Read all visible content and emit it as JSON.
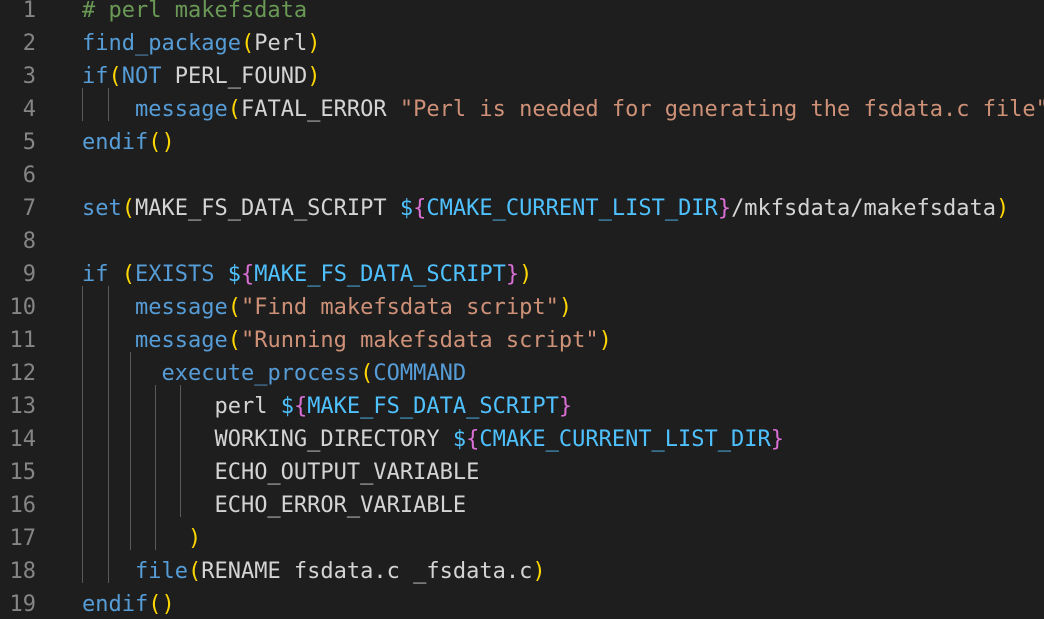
{
  "editor": {
    "lines": [
      {
        "num": "1",
        "indent": "",
        "tokens": [
          {
            "t": "# perl makefsdata",
            "c": "cmt"
          }
        ]
      },
      {
        "num": "2",
        "indent": "",
        "tokens": [
          {
            "t": "find_package",
            "c": "fn"
          },
          {
            "t": "(",
            "c": "p1"
          },
          {
            "t": "Perl",
            "c": "id"
          },
          {
            "t": ")",
            "c": "p1"
          }
        ]
      },
      {
        "num": "3",
        "indent": "",
        "tokens": [
          {
            "t": "if",
            "c": "fn"
          },
          {
            "t": "(",
            "c": "p1"
          },
          {
            "t": "NOT",
            "c": "kw"
          },
          {
            "t": " PERL_FOUND",
            "c": "id"
          },
          {
            "t": ")",
            "c": "p1"
          }
        ]
      },
      {
        "num": "4",
        "indent": "    ",
        "tokens": [
          {
            "t": "message",
            "c": "fn"
          },
          {
            "t": "(",
            "c": "p1"
          },
          {
            "t": "FATAL_ERROR ",
            "c": "id"
          },
          {
            "t": "\"Perl is needed for generating the fsdata.c file\"",
            "c": "str"
          },
          {
            "t": ")",
            "c": "p1"
          }
        ]
      },
      {
        "num": "5",
        "indent": "",
        "tokens": [
          {
            "t": "endif",
            "c": "fn"
          },
          {
            "t": "()",
            "c": "p1"
          }
        ]
      },
      {
        "num": "6",
        "indent": "",
        "tokens": []
      },
      {
        "num": "7",
        "indent": "",
        "tokens": [
          {
            "t": "set",
            "c": "fn"
          },
          {
            "t": "(",
            "c": "p1"
          },
          {
            "t": "MAKE_FS_DATA_SCRIPT ",
            "c": "id"
          },
          {
            "t": "$",
            "c": "var"
          },
          {
            "t": "{",
            "c": "p2"
          },
          {
            "t": "CMAKE_CURRENT_LIST_DIR",
            "c": "var"
          },
          {
            "t": "}",
            "c": "p2"
          },
          {
            "t": "/mkfsdata/makefsdata",
            "c": "id"
          },
          {
            "t": ")",
            "c": "p1"
          }
        ]
      },
      {
        "num": "8",
        "indent": "",
        "tokens": []
      },
      {
        "num": "9",
        "indent": "",
        "tokens": [
          {
            "t": "if",
            "c": "fn"
          },
          {
            "t": " ",
            "c": "id"
          },
          {
            "t": "(",
            "c": "p1"
          },
          {
            "t": "EXISTS ",
            "c": "kw"
          },
          {
            "t": "$",
            "c": "var"
          },
          {
            "t": "{",
            "c": "p2"
          },
          {
            "t": "MAKE_FS_DATA_SCRIPT",
            "c": "var"
          },
          {
            "t": "}",
            "c": "p2"
          },
          {
            "t": ")",
            "c": "p1"
          }
        ]
      },
      {
        "num": "10",
        "indent": "    ",
        "tokens": [
          {
            "t": "message",
            "c": "fn"
          },
          {
            "t": "(",
            "c": "p1"
          },
          {
            "t": "\"Find makefsdata script\"",
            "c": "str"
          },
          {
            "t": ")",
            "c": "p1"
          }
        ]
      },
      {
        "num": "11",
        "indent": "    ",
        "tokens": [
          {
            "t": "message",
            "c": "fn"
          },
          {
            "t": "(",
            "c": "p1"
          },
          {
            "t": "\"Running makefsdata script\"",
            "c": "str"
          },
          {
            "t": ")",
            "c": "p1"
          }
        ]
      },
      {
        "num": "12",
        "indent": "      ",
        "tokens": [
          {
            "t": "execute_process",
            "c": "fn"
          },
          {
            "t": "(",
            "c": "p1"
          },
          {
            "t": "COMMAND",
            "c": "kw"
          }
        ]
      },
      {
        "num": "13",
        "indent": "          ",
        "tokens": [
          {
            "t": "perl ",
            "c": "id"
          },
          {
            "t": "$",
            "c": "var"
          },
          {
            "t": "{",
            "c": "p2"
          },
          {
            "t": "MAKE_FS_DATA_SCRIPT",
            "c": "var"
          },
          {
            "t": "}",
            "c": "p2"
          }
        ]
      },
      {
        "num": "14",
        "indent": "          ",
        "tokens": [
          {
            "t": "WORKING_DIRECTORY ",
            "c": "id"
          },
          {
            "t": "$",
            "c": "var"
          },
          {
            "t": "{",
            "c": "p2"
          },
          {
            "t": "CMAKE_CURRENT_LIST_DIR",
            "c": "var"
          },
          {
            "t": "}",
            "c": "p2"
          }
        ]
      },
      {
        "num": "15",
        "indent": "          ",
        "tokens": [
          {
            "t": "ECHO_OUTPUT_VARIABLE",
            "c": "id"
          }
        ]
      },
      {
        "num": "16",
        "indent": "          ",
        "tokens": [
          {
            "t": "ECHO_ERROR_VARIABLE",
            "c": "id"
          }
        ]
      },
      {
        "num": "17",
        "indent": "        ",
        "tokens": [
          {
            "t": ")",
            "c": "p1"
          }
        ]
      },
      {
        "num": "18",
        "indent": "    ",
        "tokens": [
          {
            "t": "file",
            "c": "fn"
          },
          {
            "t": "(",
            "c": "p1"
          },
          {
            "t": "RENAME fsdata.c _fsdata.c",
            "c": "id"
          },
          {
            "t": ")",
            "c": "p1"
          }
        ]
      },
      {
        "num": "19",
        "indent": "",
        "tokens": [
          {
            "t": "endif",
            "c": "fn"
          },
          {
            "t": "()",
            "c": "p1"
          }
        ]
      }
    ]
  }
}
